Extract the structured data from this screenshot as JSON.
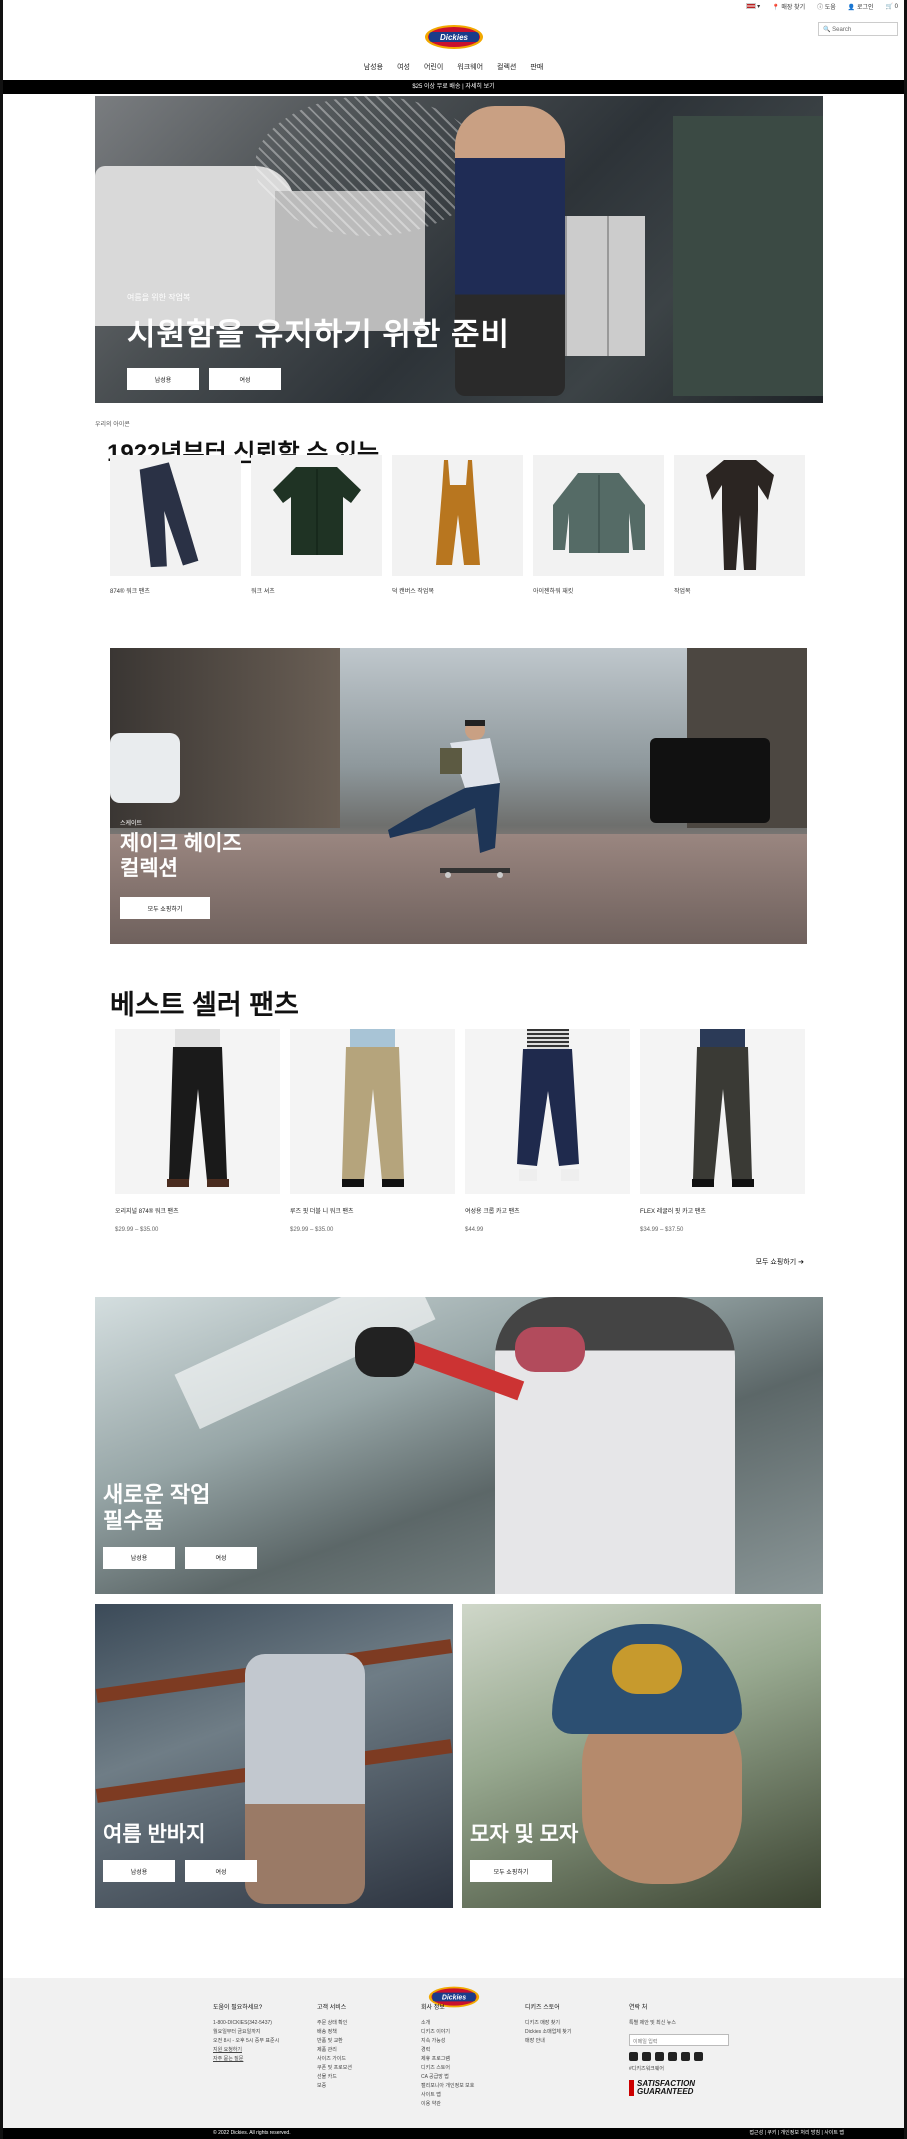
{
  "header": {
    "utility": {
      "country": "",
      "stores": "매장 찾기",
      "help": "도움",
      "login": "로그인",
      "cart": "0"
    },
    "search_placeholder": "Search",
    "logo_text": "Dickies",
    "nav": [
      "남성용",
      "여성",
      "어린이",
      "워크웨어",
      "컬렉션",
      "판매"
    ]
  },
  "promo": {
    "text": "$25 이상 무료 배송 | 자세히 보기"
  },
  "hero": {
    "eyebrow": "여름을 위한 작업복",
    "title": "시원함을 유지하기 위한 준비",
    "buttons": [
      "남성용",
      "여성"
    ]
  },
  "trusted": {
    "eyebrow": "우리의 아이콘",
    "title": "1922년부터 신뢰할 수 있는",
    "products": [
      {
        "name": "874® 워크 팬츠"
      },
      {
        "name": "워크 셔츠"
      },
      {
        "name": "덕 캔버스 작업복"
      },
      {
        "name": "아이젠하워 재킷"
      },
      {
        "name": "작업복"
      }
    ]
  },
  "jake": {
    "eyebrow": "스케이트",
    "title_line1": "제이크 헤이즈",
    "title_line2": "컬렉션",
    "button": "모두 쇼핑하기"
  },
  "bestsellers": {
    "title": "베스트 셀러 팬츠",
    "prev": "◂",
    "next": "▸",
    "items": [
      {
        "name": "오리지널 874® 워크 팬츠",
        "price": "$29.99 – $35.00"
      },
      {
        "name": "루즈 핏 더블 니 워크 팬츠",
        "price": "$29.99 – $35.00"
      },
      {
        "name": "여성용 크롭 카고 팬츠",
        "price": "$44.99"
      },
      {
        "name": "FLEX 레귤러 핏 카고 팬츠",
        "price": "$34.99 – $37.50"
      }
    ],
    "shop_all": "모두 쇼핑하기 ➔"
  },
  "work": {
    "title_line1": "새로운 작업",
    "title_line2": "필수품",
    "buttons": [
      "남성용",
      "여성"
    ]
  },
  "shorts": {
    "title": "여름 반바지",
    "buttons": [
      "남성용",
      "여성"
    ]
  },
  "hats": {
    "title": "모자 및 모자",
    "button": "모두 쇼핑하기"
  },
  "footer": {
    "cols": [
      {
        "title": "도움이 필요하세요?",
        "items": [
          "1-800-DICKIES(342-5437)",
          "월요일부터 금요일까지",
          "오전 8시 - 오후 5시 중부 표준시",
          "지원 요청하기",
          "자주 묻는 질문"
        ]
      },
      {
        "title": "고객 서비스",
        "items": [
          "주문 상태 확인",
          "배송 정책",
          "반품 및 교환",
          "제품 관리",
          "사이즈 가이드",
          "쿠폰 및 프로모션",
          "선물 카드",
          "보증"
        ]
      },
      {
        "title": "회사 정보",
        "items": [
          "소개",
          "디키즈 이야기",
          "지속 가능성",
          "경력",
          "제휴 프로그램",
          "디키즈 스토어",
          "CA 공급망 법",
          "캘리포니아 개인정보 보호",
          "사이트 맵",
          "이용 약관"
        ]
      },
      {
        "title": "디키즈 스토어",
        "items": [
          "디키즈 매장 찾기",
          "Dickies 소매업체 찾기",
          "매장 안내"
        ]
      },
      {
        "title": "연락 처",
        "items": [
          "특별 제안 및 최신 뉴스",
          "#디키즈워크웨어"
        ]
      }
    ],
    "email_placeholder": "이메일 입력",
    "guarantee_line1": "SATISFACTION",
    "guarantee_line2": "GUARANTEED",
    "copyright": "© 2022 Dickies. All rights reserved.",
    "legal": "접근성 | 쿠키 | 개인정보 처리 방침 | 사이트 맵"
  }
}
